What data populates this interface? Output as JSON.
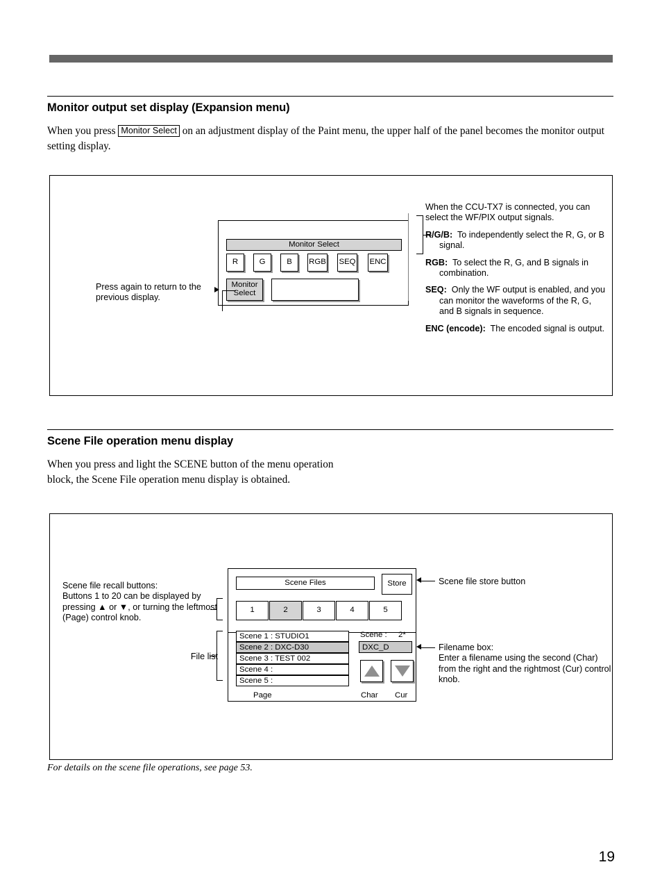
{
  "page": {
    "number": "19"
  },
  "section1": {
    "heading": "Monitor output set display (Expansion menu)",
    "intro_before": "When you press",
    "intro_key": "Monitor Select",
    "intro_after": "on an adjustment display of the Paint menu, the upper half of the panel becomes the monitor output setting display.",
    "panel": {
      "titlebar": "Monitor Select",
      "buttons": [
        "R",
        "G",
        "B",
        "RGB",
        "SEQ",
        "ENC"
      ],
      "mode_button_line1": "Monitor",
      "mode_button_line2": "Select"
    },
    "callout_left": "Press again to return to the previous display.",
    "callout_right": {
      "intro": "When the CCU-TX7 is connected, you can select the WF/PIX output signals.",
      "items": [
        {
          "term": "R/G/B:",
          "desc": "To independently select the R, G, or B signal."
        },
        {
          "term": "RGB:",
          "desc": "To select the R, G, and B signals in combination."
        },
        {
          "term": "SEQ:",
          "desc": "Only the WF output is enabled, and you can monitor the waveforms of the R, G, and B signals in sequence."
        },
        {
          "term": "ENC (encode):",
          "desc": "The encoded signal is output."
        }
      ]
    }
  },
  "section2": {
    "heading": "Scene File operation menu display",
    "intro": "When you press and light the SCENE button of the menu operation block, the Scene File operation menu display is obtained.",
    "panel": {
      "titlebar": "Scene Files",
      "store_button": "Store",
      "page_buttons": [
        "1",
        "2",
        "3",
        "4",
        "5"
      ],
      "selected_page": "2",
      "file_list": [
        "Scene 1 : STUDIO1",
        "Scene 2 : DXC-D30",
        "Scene 3 : TEST 002",
        "Scene 4 :",
        "Scene 5 :"
      ],
      "selected_file_index": 1,
      "page_label": "Page",
      "scene_label": "Scene :",
      "scene_value": "2*",
      "filename_value": "DXC_D",
      "char_label": "Char",
      "cur_label": "Cur"
    },
    "callout_recall": "Scene file recall buttons:\nButtons 1 to 20 can be displayed by pressing ▲ or ▼, or turning the leftmost (Page) control knob.",
    "callout_filelist": "File list",
    "callout_store": "Scene file store  button",
    "callout_filename_title": "Filename box:",
    "callout_filename_body": "Enter a filename using the second (Char) from the right and the rightmost (Cur) control knob."
  },
  "xref": "For details on the scene file operations, see page 53."
}
